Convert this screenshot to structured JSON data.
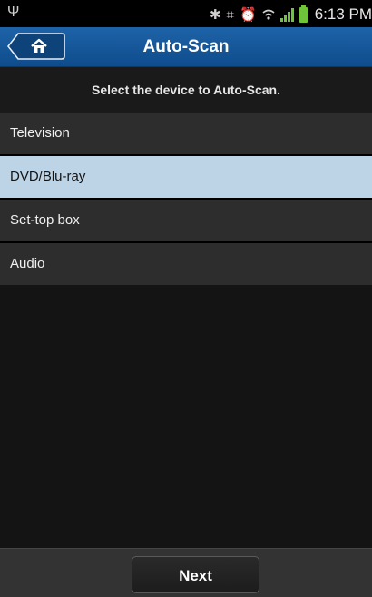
{
  "status_bar": {
    "time": "6:13 PM",
    "icons": [
      "usb-icon",
      "bluetooth-icon",
      "nfc-icon",
      "alarm-icon",
      "wifi-icon",
      "signal-icon",
      "battery-icon"
    ],
    "battery_color": "#6fc53a"
  },
  "header": {
    "title": "Auto-Scan",
    "home_icon": "home-icon",
    "accent_color": "#1e63a8"
  },
  "subtitle": "Select the device to Auto-Scan.",
  "devices": [
    {
      "label": "Television",
      "selected": false
    },
    {
      "label": "DVD/Blu-ray",
      "selected": true
    },
    {
      "label": "Set-top box",
      "selected": false
    },
    {
      "label": "Audio",
      "selected": false
    }
  ],
  "footer": {
    "next_label": "Next"
  }
}
